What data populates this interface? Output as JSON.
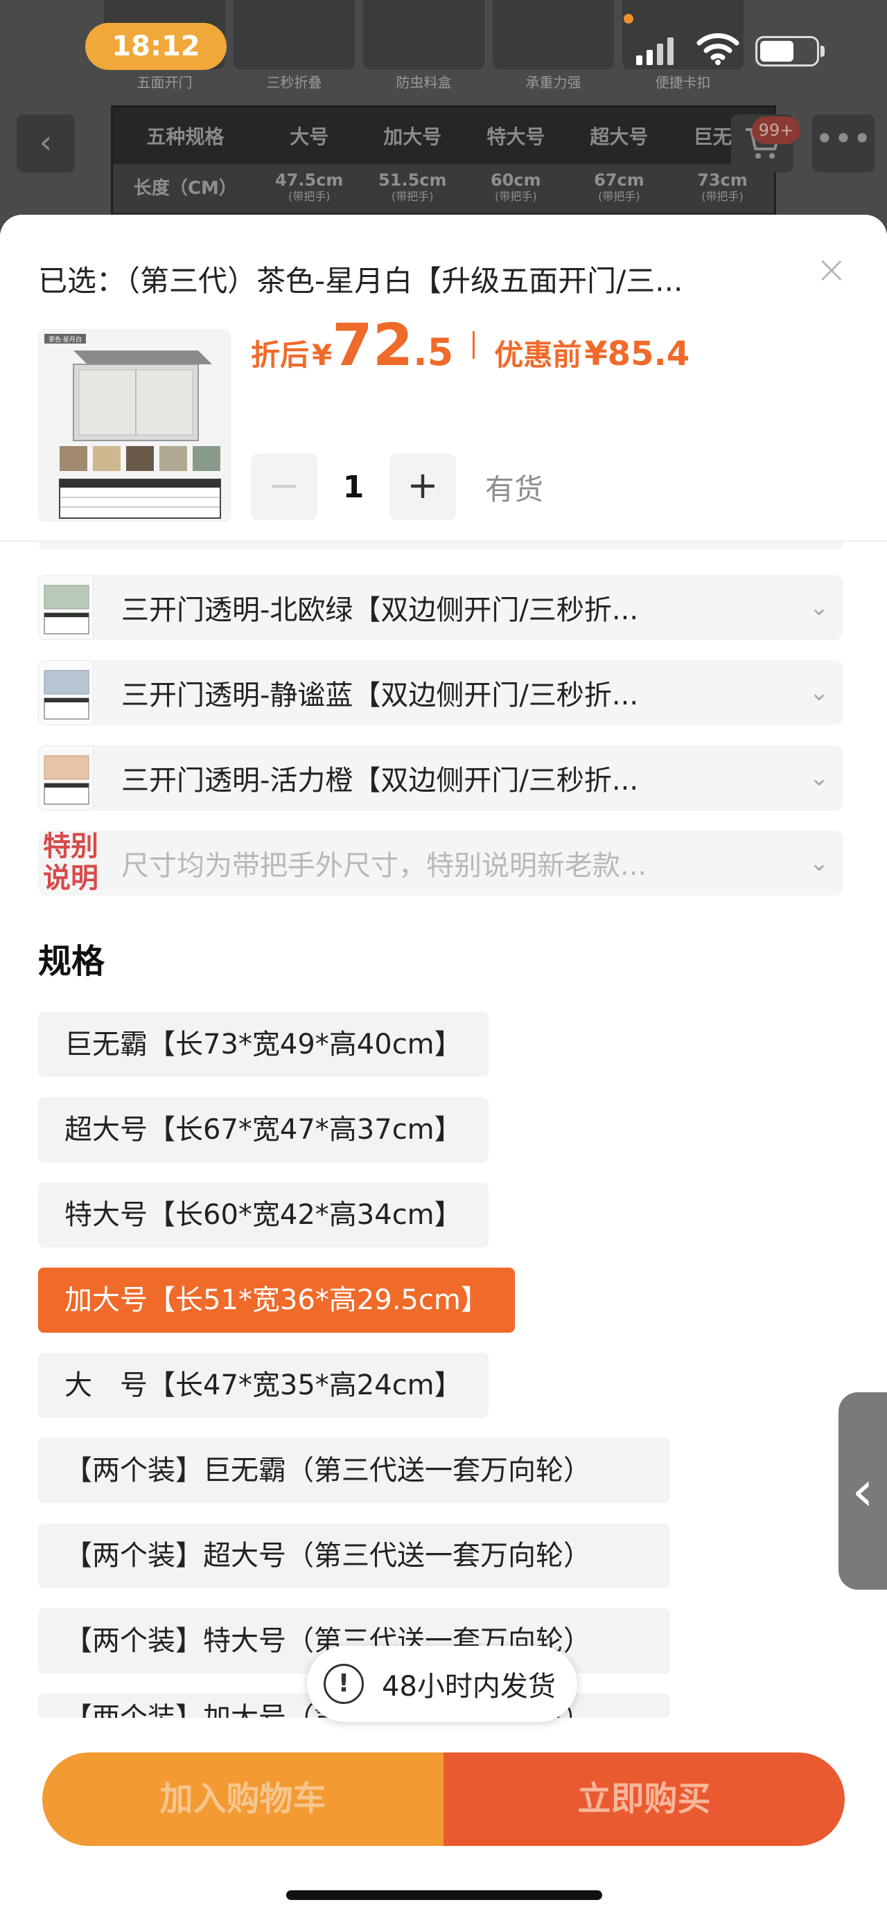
{
  "status_bar": {
    "time": "18:12"
  },
  "background": {
    "thumb_labels": [
      "五面开门",
      "三秒折叠",
      "防虫料盒",
      "承重力强",
      "便捷卡扣"
    ],
    "spec_table": {
      "headers": [
        "五种规格",
        "大号",
        "加大号",
        "特大号",
        "超大号",
        "巨无霸"
      ],
      "row_label": "长度（CM）",
      "values": [
        "47.5cm",
        "51.5cm",
        "60cm",
        "67cm",
        "73cm"
      ],
      "note": "(带把手)"
    },
    "cart_badge": "99+"
  },
  "sheet": {
    "selected_text": "已选：（第三代）茶色-星月白【升级五面开门/三...",
    "price": {
      "discount_label": "折后",
      "yen": "¥",
      "integer": "72",
      "decimal": ".5",
      "original_label": "优惠前",
      "original_price": "¥85.4"
    },
    "quantity": "1",
    "stock": "有货",
    "thumb_label": "茶色·星月白"
  },
  "colors": [
    {
      "label": "三开门透明-北欧绿【双边侧开门/三秒折..."
    },
    {
      "label": "三开门透明-静谧蓝【双边侧开门/三秒折..."
    },
    {
      "label": "三开门透明-活力橙【双边侧开门/三秒折..."
    }
  ],
  "note_row": {
    "badge_line1": "特别",
    "badge_line2": "说明",
    "text": "尺寸均为带把手外尺寸，特别说明新老款..."
  },
  "spec_section_title": "规格",
  "specs": [
    "巨无霸【长73*宽49*高40cm】",
    "超大号【长67*宽47*高37cm】",
    "特大号【长60*宽42*高34cm】",
    "加大号【长51*宽36*高29.5cm】",
    "大　号【长47*宽35*高24cm】",
    "【两个装】巨无霸（第三代送一套万向轮）",
    "【两个装】超大号（第三代送一套万向轮）",
    "【两个装】特大号（第三代送一套万向轮）",
    "【两个装】加大号（第三代送一套万向轮）"
  ],
  "toast": {
    "text": "48小时内发货"
  },
  "actions": {
    "add_cart": "加入购物车",
    "buy_now": "立即购买"
  },
  "colors_theme": {
    "accent": "#f06a2a",
    "cart_button": "#f39a33",
    "buy_button": "#ea5a30",
    "note_badge": "#d74b4b"
  }
}
